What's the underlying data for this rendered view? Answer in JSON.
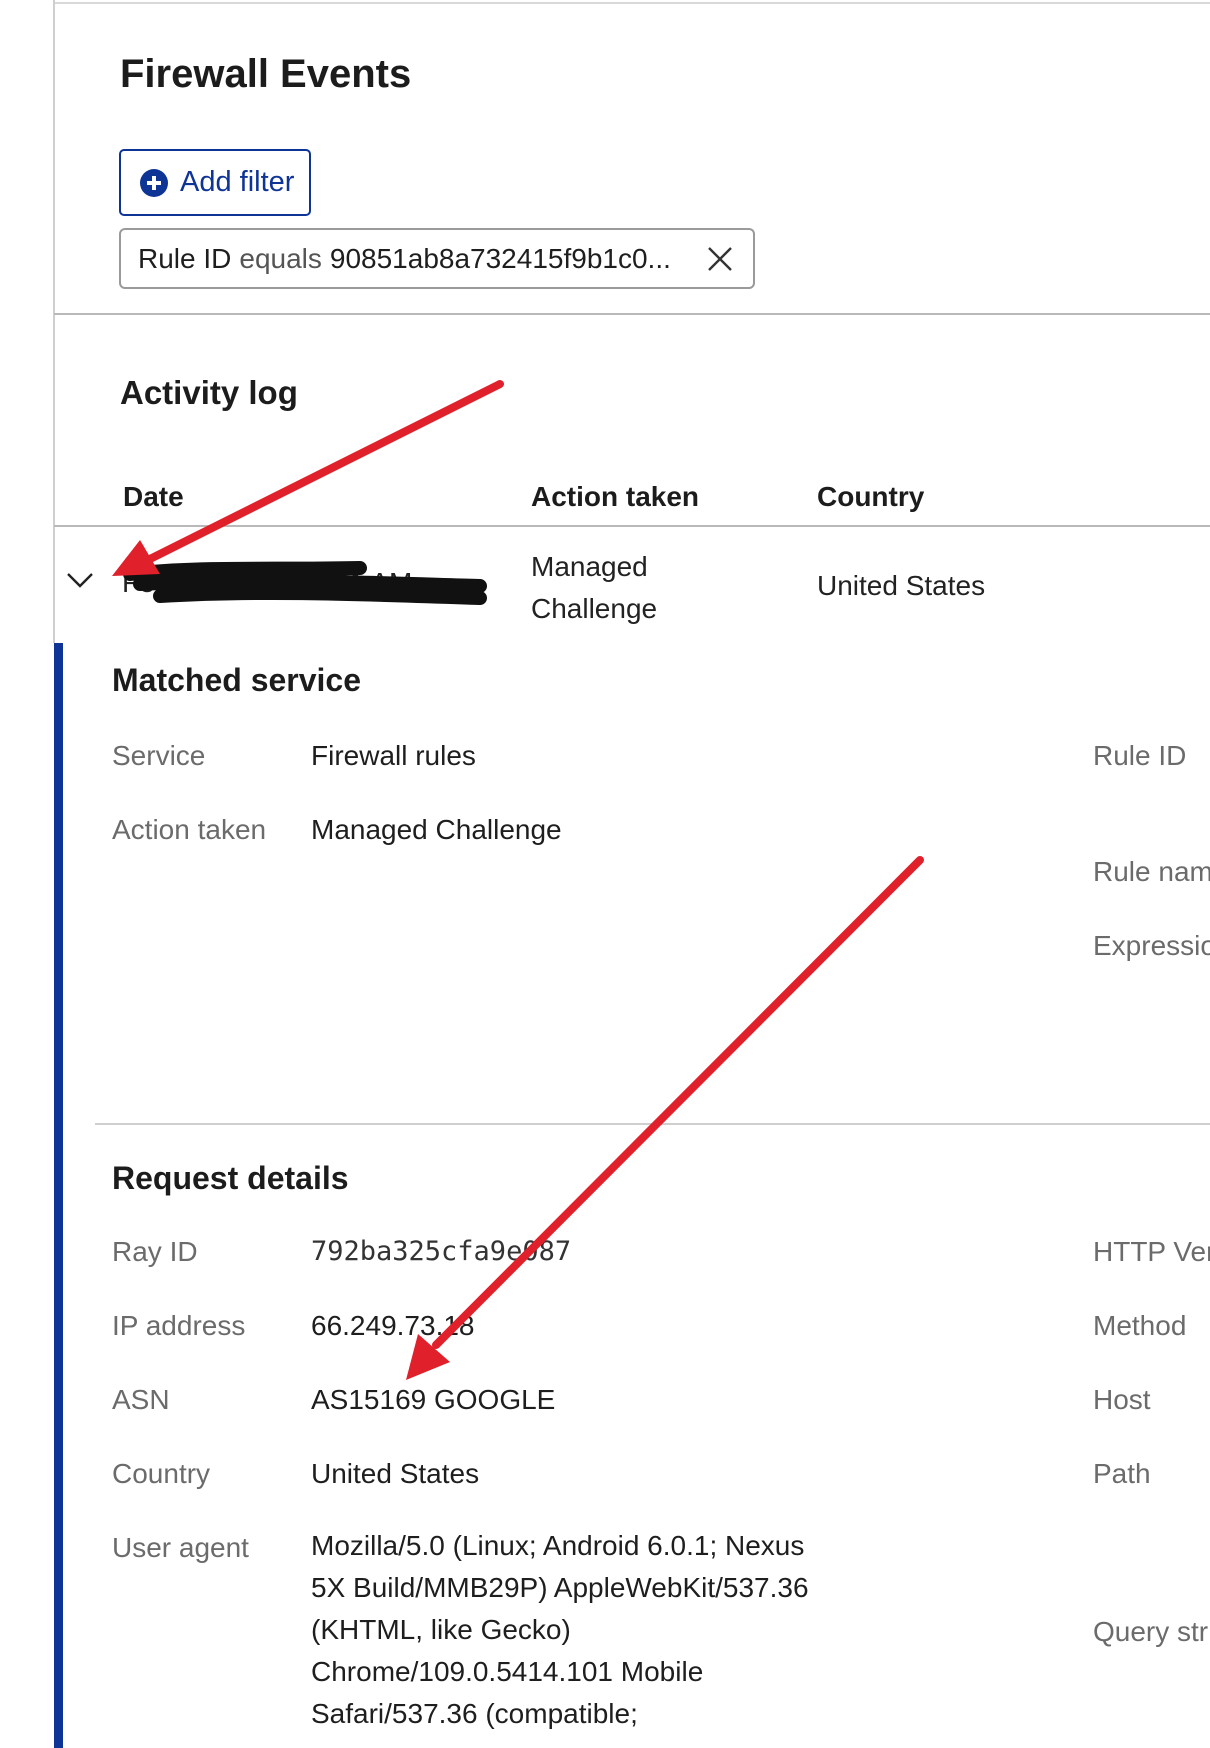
{
  "page": {
    "title": "Firewall Events"
  },
  "filters": {
    "add_filter_label": "Add filter",
    "active_filter": {
      "field": "Rule ID",
      "operator": "equals",
      "value": "90851ab8a732415f9b1c0..."
    }
  },
  "activity_log": {
    "title": "Activity log",
    "columns": [
      "Date",
      "Action taken",
      "Country"
    ],
    "row": {
      "date_visible_start": "Fe",
      "date_visible_end": "21 AM",
      "action_line1": "Managed",
      "action_line2": "Challenge",
      "country": "United States"
    }
  },
  "matched_service": {
    "title": "Matched service",
    "service_label": "Service",
    "service_value": "Firewall rules",
    "action_label": "Action taken",
    "action_value": "Managed Challenge",
    "rule_id_label": "Rule ID",
    "rule_name_label": "Rule nam",
    "expression_label": "Expressio"
  },
  "request_details": {
    "title": "Request details",
    "ray_id_label": "Ray ID",
    "ray_id_value": "792ba325cfa9e087",
    "ip_label": "IP address",
    "ip_value": "66.249.73.18",
    "asn_label": "ASN",
    "asn_value": "AS15169 GOOGLE",
    "country_label": "Country",
    "country_value": "United States",
    "ua_label": "User agent",
    "ua_value": "Mozilla/5.0 (Linux; Android 6.0.1; Nexus 5X Build/MMB29P) AppleWebKit/537.36 (KHTML, like Gecko) Chrome/109.0.5414.101 Mobile Safari/537.36 (compatible;",
    "http_version_label": "HTTP Ver",
    "method_label": "Method",
    "host_label": "Host",
    "path_label": "Path",
    "query_label": "Query str"
  },
  "annotations": {
    "arrow_color": "#e0202a",
    "redaction_color": "#111111"
  }
}
